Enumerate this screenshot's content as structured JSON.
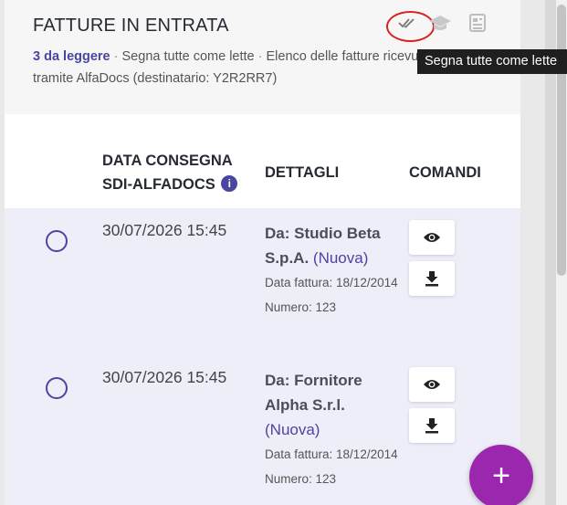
{
  "header": {
    "title": "FATTURE IN ENTRATA",
    "unread": "3 da leggere",
    "sep1": " · ",
    "mark_all": "Segna tutte come lette",
    "sep2": " · ",
    "description": "Elenco delle fatture ricevute tramite AlfaDocs (destinatario: Y2R2RR7)",
    "tooltip": "Segna tutte come lette"
  },
  "table": {
    "columns": {
      "date": "DATA CONSEGNA SDI-ALFADOCS",
      "details": "DETTAGLI",
      "commands": "COMANDI"
    },
    "info_icon": "i",
    "rows": [
      {
        "date": "30/07/2026 15:45",
        "sender": "Da: Studio Beta S.p.A.",
        "status": "(Nuova)",
        "invoice_date": "Data fattura: 18/12/2014",
        "number": "Numero: 123"
      },
      {
        "date": "30/07/2026 15:45",
        "sender": "Da: Fornitore Alpha S.r.l.",
        "status": "(Nuova)",
        "invoice_date": "Data fattura: 18/12/2014",
        "number": "Numero: 123"
      }
    ]
  },
  "fab": {
    "label": "+"
  },
  "icons": [
    "double-check-icon",
    "graduation-cap-icon",
    "document-icon",
    "info-icon",
    "eye-icon",
    "download-icon",
    "plus-icon"
  ],
  "colors": {
    "accent": "#4a45a0",
    "fab": "#9b27af",
    "row_bg": "#eeeef9",
    "highlight": "#d92020"
  }
}
